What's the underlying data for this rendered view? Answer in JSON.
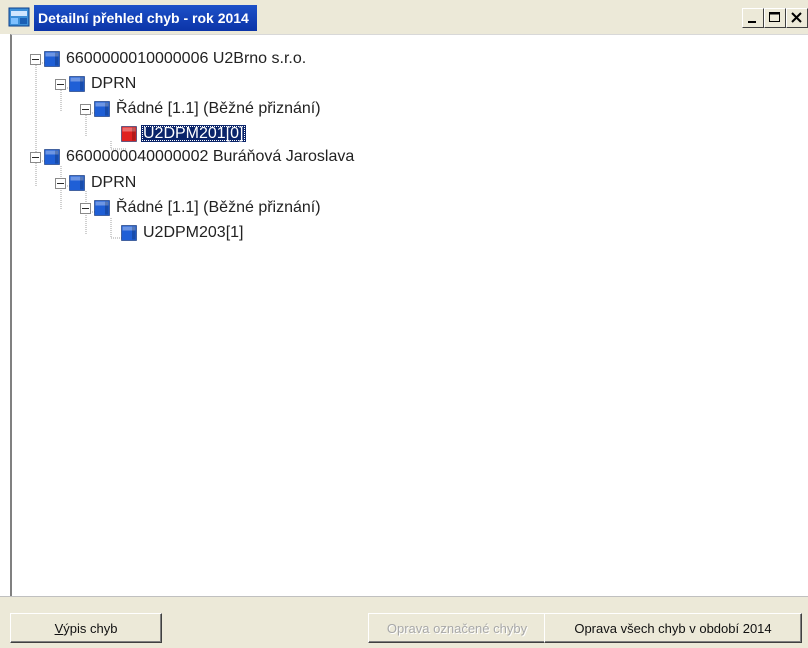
{
  "window": {
    "title": "Detailní přehled chyb - rok 2014",
    "buttons": [
      "minimize-button",
      "maximize-button",
      "close-button"
    ]
  },
  "tree": {
    "nodes": [
      {
        "label": "6600000010000006  U2Brno s.r.o.",
        "level": 0,
        "expander": "minus",
        "icon": "blue-cube-icon",
        "selected": false
      },
      {
        "label": "DPRN",
        "level": 1,
        "expander": "minus",
        "icon": "blue-cube-icon",
        "selected": false
      },
      {
        "label": "Řádné [1.1]  (Běžné přiznání)",
        "level": 2,
        "expander": "minus",
        "icon": "blue-cube-icon",
        "selected": false
      },
      {
        "label": "U2DPM201[0]",
        "level": 3,
        "expander": "none",
        "icon": "red-cube-icon",
        "selected": true
      },
      {
        "label": "6600000040000002  Buráňová Jaroslava",
        "level": 0,
        "expander": "minus",
        "icon": "blue-cube-icon",
        "selected": false
      },
      {
        "label": "DPRN",
        "level": 1,
        "expander": "minus",
        "icon": "blue-cube-icon",
        "selected": false
      },
      {
        "label": "Řádné [1.1]  (Běžné přiznání)",
        "level": 2,
        "expander": "minus",
        "icon": "blue-cube-icon",
        "selected": false
      },
      {
        "label": "U2DPM203[1]",
        "level": 3,
        "expander": "none",
        "icon": "blue-cube-icon",
        "selected": false
      }
    ]
  },
  "buttons": {
    "list_errors": {
      "label": "Výpis chyb",
      "mnemonic": "V",
      "rest": "ýpis chyb",
      "enabled": true
    },
    "fix_marked": {
      "label": "Oprava označené chyby",
      "enabled": false
    },
    "fix_all": {
      "label": "Oprava všech chyb v období 2014",
      "enabled": true
    }
  },
  "colors": {
    "title_bar": "#0b34a8",
    "selection": "#0a246a",
    "window_face": "#ece9d8",
    "cube_blue": "#1f5fd6",
    "cube_red": "#e02020"
  }
}
